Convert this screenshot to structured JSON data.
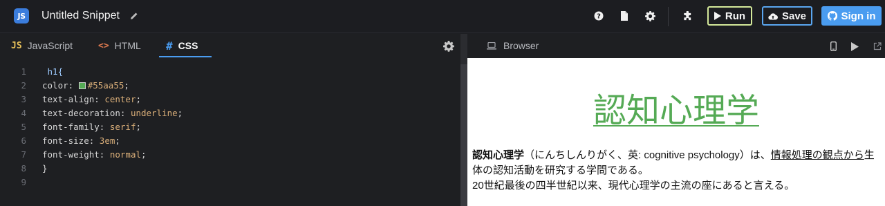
{
  "app": {
    "logo_text": "JS",
    "title": "Untitled Snippet"
  },
  "toolbar": {
    "run_label": "Run",
    "save_label": "Save",
    "signin_label": "Sign in"
  },
  "editor": {
    "tabs": [
      {
        "icon": "JS",
        "label": "JavaScript"
      },
      {
        "icon": "<>",
        "label": "HTML"
      },
      {
        "icon": "#",
        "label": "CSS"
      }
    ],
    "active_tab": "CSS",
    "lines": [
      {
        "n": "1",
        "selector": " h1{"
      },
      {
        "n": "2",
        "prop": "color: ",
        "swatch": "#55aa55",
        "val": "#55aa55",
        "end": ";"
      },
      {
        "n": "3",
        "prop": "text-align: ",
        "val": "center",
        "end": ";"
      },
      {
        "n": "4",
        "prop": "text-decoration: ",
        "val": "underline",
        "end": ";"
      },
      {
        "n": "5",
        "prop": "font-family: ",
        "val": "serif",
        "end": ";"
      },
      {
        "n": "6",
        "prop": "font-size: ",
        "val": "3em",
        "end": ";"
      },
      {
        "n": "7",
        "prop": "font-weight: ",
        "val": "normal",
        "end": ";"
      },
      {
        "n": "8",
        "plain": "}"
      },
      {
        "n": "9",
        "plain": ""
      }
    ]
  },
  "browser": {
    "tab_label": "Browser",
    "heading": "認知心理学",
    "paragraph": {
      "bold": "認知心理学",
      "rest1": "（にんちしんりがく、英: cognitive psychology）は、",
      "link": "情報処理の観点から",
      "rest2": "生体の認知活動を研究する学問である。",
      "line3": "20世紀最後の四半世紀以来、現代心理学の主流の座にあると言える。"
    }
  },
  "colors": {
    "heading_color": "#55aa55",
    "accent": "#4a9cf0",
    "run_border": "#d4e99a"
  }
}
